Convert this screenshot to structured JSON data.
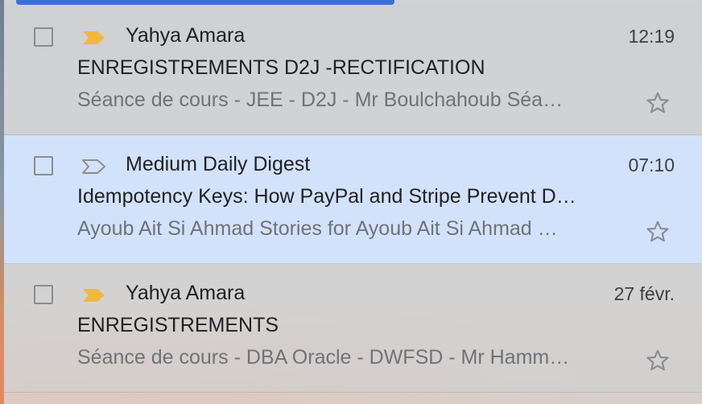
{
  "colors": {
    "accent": "#3b6fd6",
    "selected_row": "#d3e2fb",
    "important_marker": "#f2b73e"
  },
  "emails": [
    {
      "sender": "Yahya Amara",
      "time": "12:19",
      "subject": "ENREGISTREMENTS D2J -RECTIFICATION",
      "snippet": "Séance de cours - JEE - D2J - Mr Boulchahoub Séa…",
      "important": true,
      "selected": false,
      "starred": false,
      "label_icon": "important-marker-icon"
    },
    {
      "sender": "Medium Daily Digest",
      "time": "07:10",
      "subject": "Idempotency Keys: How PayPal and Stripe Prevent D…",
      "snippet": "Ayoub Ait Si Ahmad Stories for Ayoub Ait Si Ahmad …",
      "important": false,
      "selected": true,
      "starred": false,
      "label_icon": "important-marker-outline-icon"
    },
    {
      "sender": "Yahya Amara",
      "time": "27 févr.",
      "subject": "ENREGISTREMENTS",
      "snippet": "Séance de cours - DBA Oracle - DWFSD - Mr Hamm…",
      "important": true,
      "selected": false,
      "starred": false,
      "label_icon": "important-marker-icon"
    }
  ]
}
